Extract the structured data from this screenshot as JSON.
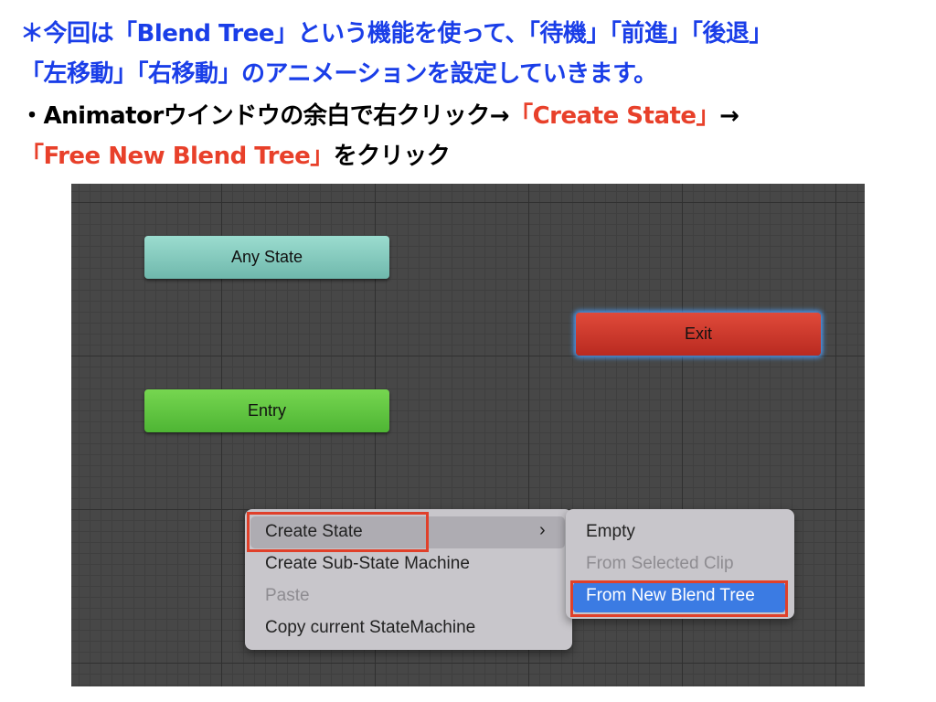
{
  "instructions": {
    "line1": "＊今回は「Blend Tree」という機能を使って、「待機」「前進」「後退」",
    "line2": "「左移動」「右移動」のアニメーションを設定していきます。",
    "line3_black": "・Animatorウインドウの余白で右クリック→",
    "line3_red": "「Create State」",
    "line3_arrow": "→",
    "line4_red": "「Free New Blend Tree」",
    "line4_black": "をクリック"
  },
  "animator": {
    "nodes": {
      "any_state": "Any State",
      "exit": "Exit",
      "entry": "Entry"
    },
    "context_menu": {
      "items": [
        "Create State",
        "Create Sub-State Machine",
        "Paste",
        "Copy current StateMachine"
      ],
      "submenu_arrow": "›"
    },
    "submenu": {
      "items": [
        "Empty",
        "From Selected Clip",
        "From New Blend Tree"
      ]
    }
  },
  "colors": {
    "blue_text": "#1a3ee8",
    "red_text": "#e8402a",
    "highlight": "#3b7be3",
    "any_state": "#8dd3c7",
    "entry": "#5cc13f",
    "exit": "#d13a2c"
  }
}
